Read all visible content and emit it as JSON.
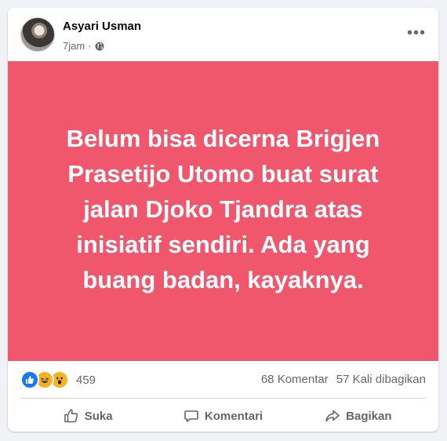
{
  "post": {
    "author": "Asyari Usman",
    "time": "7jam",
    "separator": "·",
    "privacy_icon": "globe-icon",
    "more_label": "•••",
    "banner_text": "Belum bisa dicerna Brigjen Prasetijo Utomo buat surat jalan Djoko Tjandra atas inisiatif sendiri. Ada yang buang badan, kayaknya.",
    "banner_color": "#f0566c"
  },
  "stats": {
    "reaction_icons": [
      "like-icon",
      "haha-icon",
      "wow-icon"
    ],
    "reaction_count": "459",
    "comments": "68 Komentar",
    "shares": "57 Kali dibagikan"
  },
  "actions": {
    "like": "Suka",
    "comment": "Komentari",
    "share": "Bagikan"
  },
  "colors": {
    "like_blue": "#1877f2",
    "emoji_yellow": "#f7b125",
    "meta_gray": "#65676b"
  }
}
